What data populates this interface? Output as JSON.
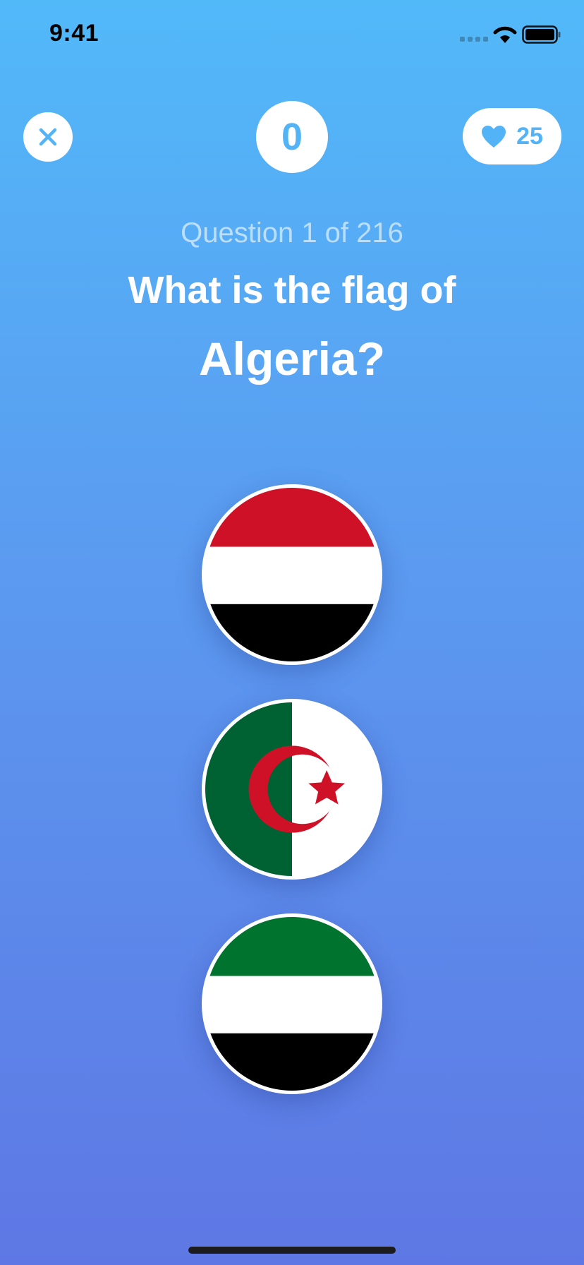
{
  "status_bar": {
    "time": "9:41"
  },
  "header": {
    "close_icon": "close-icon",
    "score": "0",
    "lives": "25",
    "heart_icon": "heart-icon"
  },
  "question": {
    "counter": "Question 1 of 216",
    "prompt": "What is the flag of",
    "country": "Algeria?"
  },
  "options": [
    {
      "flag": "red-white-black horizontal tricolor"
    },
    {
      "flag": "algeria"
    },
    {
      "flag": "green-white-black horizontal tricolor"
    }
  ],
  "colors": {
    "accent": "#52b3f6",
    "gradient_top": "#52b9f9",
    "gradient_bottom": "#5e77e4",
    "flag_red": "#ce1126",
    "flag_green_algeria": "#006233",
    "flag_green_option3": "#00732f",
    "flag_black": "#000000"
  }
}
